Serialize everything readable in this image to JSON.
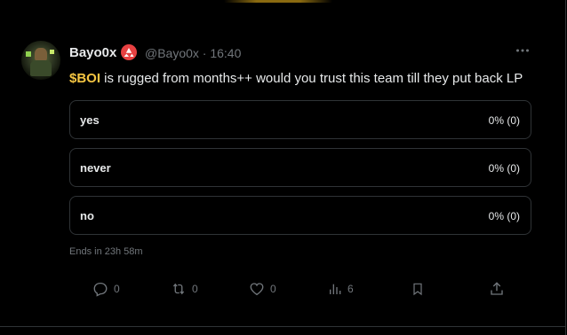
{
  "tweet": {
    "author_name": "Bayo0x",
    "handle_time": "@Bayo0x · 16:40",
    "cashtag": "$BOI",
    "text_rest": " is rugged from months++ would you trust this team till they put back LP"
  },
  "poll": {
    "options": [
      {
        "label": "yes",
        "result": "0% (0)",
        "fraction": 0
      },
      {
        "label": "never",
        "result": "0% (0)",
        "fraction": 0
      },
      {
        "label": "no",
        "result": "0% (0)",
        "fraction": 0
      }
    ],
    "ends_text": "Ends in 23h 58m"
  },
  "actions": {
    "reply_count": "0",
    "repost_count": "0",
    "like_count": "0",
    "views_count": "6"
  },
  "icons": [
    "avatar",
    "avalanche-badge-icon",
    "more-icon",
    "reply-icon",
    "repost-icon",
    "like-icon",
    "views-icon",
    "bookmark-icon",
    "share-icon"
  ],
  "colors": {
    "background": "#000000",
    "text": "#e7e9ea",
    "muted": "#71767b",
    "border": "#2f3336",
    "cashtag": "#f5c542",
    "badge": "#e84142"
  }
}
